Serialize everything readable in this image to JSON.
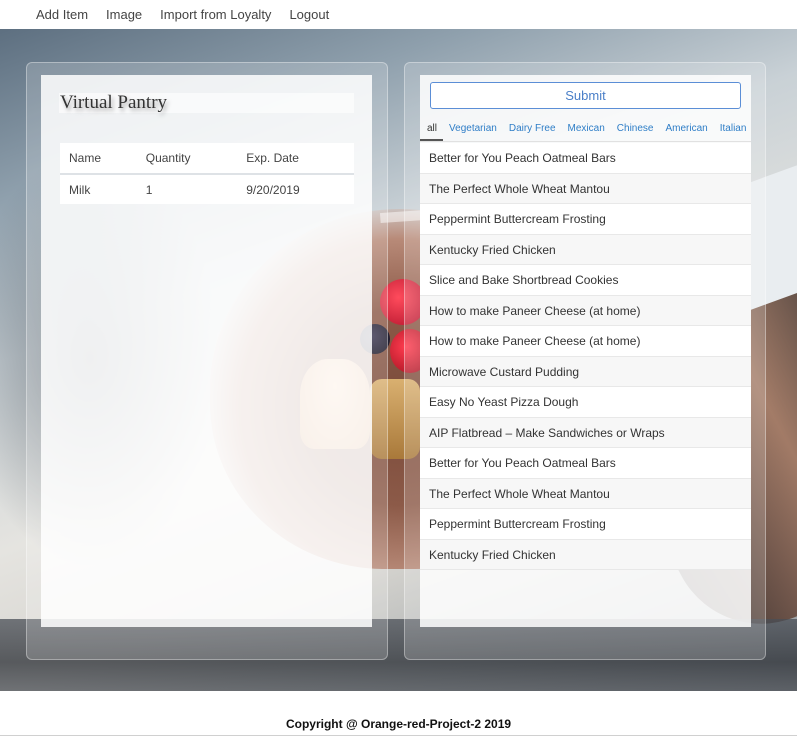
{
  "nav": {
    "items": [
      "Add Item",
      "Image",
      "Import from Loyalty",
      "Logout"
    ]
  },
  "pantry": {
    "title": "Virtual Pantry",
    "columns": [
      "Name",
      "Quantity",
      "Exp. Date"
    ],
    "rows": [
      {
        "name": "Milk",
        "quantity": "1",
        "exp": "9/20/2019"
      }
    ]
  },
  "recipes": {
    "submit_label": "Submit",
    "tabs": [
      "all",
      "Vegetarian",
      "Dairy Free",
      "Mexican",
      "Chinese",
      "American",
      "Italian"
    ],
    "active_tab": "all",
    "items": [
      "Better for You Peach Oatmeal Bars",
      "The Perfect Whole Wheat Mantou",
      "Peppermint Buttercream Frosting",
      "Kentucky Fried Chicken",
      "Slice and Bake Shortbread Cookies",
      "How to make Paneer Cheese (at home)",
      "How to make Paneer Cheese (at home)",
      "Microwave Custard Pudding",
      "Easy No Yeast Pizza Dough",
      "AIP Flatbread – Make Sandwiches or Wraps",
      "Better for You Peach Oatmeal Bars",
      "The Perfect Whole Wheat Mantou",
      "Peppermint Buttercream Frosting",
      "Kentucky Fried Chicken"
    ]
  },
  "footer": {
    "text": "Copyright @ Orange-red-Project-2 2019"
  },
  "colors": {
    "accent": "#4a7fc8",
    "tab_link": "#2f7ec7"
  }
}
